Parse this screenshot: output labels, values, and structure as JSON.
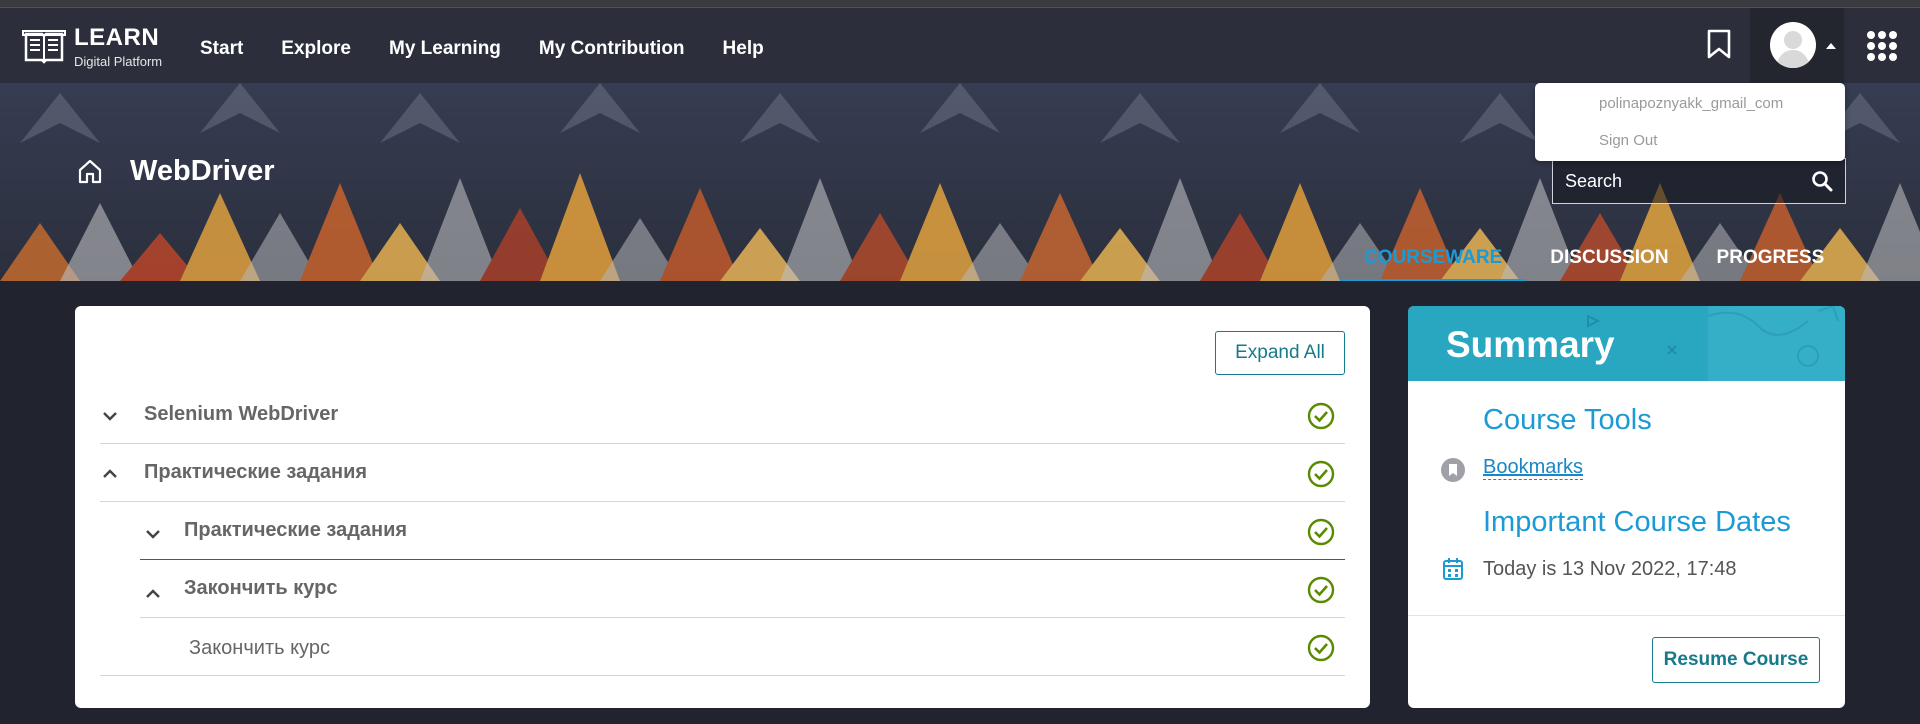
{
  "brand": {
    "name": "LEARN",
    "tagline": "Digital Platform"
  },
  "nav": {
    "items": [
      "Start",
      "Explore",
      "My Learning",
      "My Contribution",
      "Help"
    ]
  },
  "user_menu": {
    "username": "polinapoznyakk_gmail_com",
    "sign_out": "Sign Out"
  },
  "course": {
    "title": "WebDriver"
  },
  "search": {
    "placeholder": "Search"
  },
  "tabs": [
    {
      "label": "COURSEWARE",
      "active": true
    },
    {
      "label": "DISCUSSION",
      "active": false
    },
    {
      "label": "PROGRESS",
      "active": false
    }
  ],
  "outline": {
    "expand_all": "Expand All",
    "rows": [
      {
        "label": "Selenium WebDriver",
        "state": "collapsed",
        "complete": true
      },
      {
        "label": "Практические задания",
        "state": "expanded",
        "complete": true
      },
      {
        "label": "Практические задания",
        "state": "collapsed",
        "complete": true
      },
      {
        "label": "Закончить курс",
        "state": "expanded",
        "complete": true
      },
      {
        "label": "Закончить курс",
        "state": "leaf",
        "complete": true
      }
    ]
  },
  "summary": {
    "title": "Summary",
    "tools_title": "Course Tools",
    "bookmarks": "Bookmarks",
    "dates_title": "Important Course Dates",
    "today": "Today is 13 Nov 2022, 17:48",
    "resume": "Resume Course"
  },
  "colors": {
    "accent": "#1b9ad6",
    "check": "#5a8a00",
    "teal": "#167a8a",
    "topbar": "#2c2f3b"
  }
}
